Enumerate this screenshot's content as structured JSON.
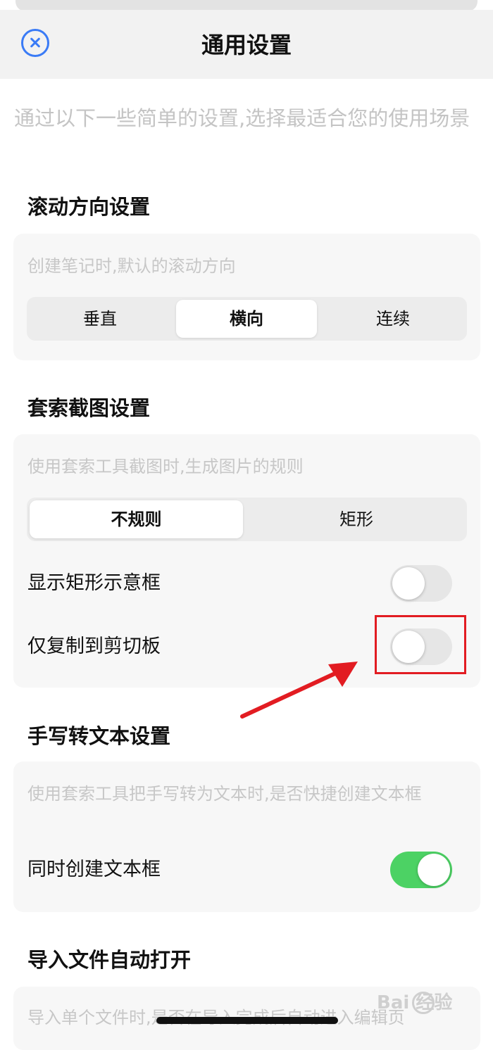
{
  "header": {
    "title": "通用设置"
  },
  "intro": "通过以下一些简单的设置,选择最适合您的使用场景",
  "scroll_section": {
    "title": "滚动方向设置",
    "desc": "创建笔记时,默认的滚动方向",
    "options": [
      "垂直",
      "横向",
      "连续"
    ],
    "selected": "横向"
  },
  "lasso_section": {
    "title": "套索截图设置",
    "desc": "使用套索工具截图时,生成图片的规则",
    "options": [
      "不规则",
      "矩形"
    ],
    "selected": "不规则",
    "show_rect_label": "显示矩形示意框",
    "show_rect_on": false,
    "copy_clipboard_label": "仅复制到剪切板",
    "copy_clipboard_on": false
  },
  "handwriting_section": {
    "title": "手写转文本设置",
    "desc": "使用套索工具把手写转为文本时,是否快捷创建文本框",
    "create_textbox_label": "同时创建文本框",
    "create_textbox_on": true
  },
  "import_section": {
    "title": "导入文件自动打开",
    "desc": "导入单个文件时,是否在导入完成后自动进入编辑页"
  },
  "watermark": {
    "text": "Bai 经验"
  },
  "colors": {
    "accent": "#3a7bf6",
    "toggle_on": "#4cd264",
    "highlight": "#e21c22"
  }
}
